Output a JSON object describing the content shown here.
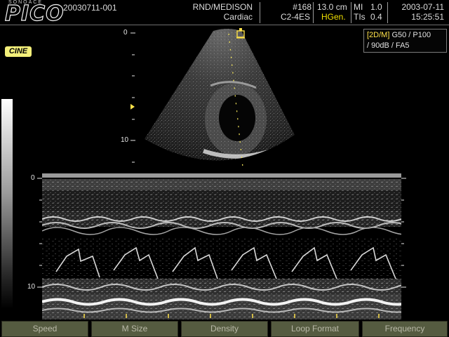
{
  "header": {
    "brand_small": "SONOACE",
    "brand_main": "PICO",
    "patient_id": "20030711-001",
    "institution": "RND/MEDISON",
    "application": "Cardiac",
    "image_number": "#168",
    "probe": "C2-4ES",
    "depth": "13.0 cm",
    "mode_mark": "HGen.",
    "mi_label": "MI",
    "mi_value": "1.0",
    "tis_label": "TIs",
    "tis_value": "0.4",
    "date": "2003-07-11",
    "time": "15:25:51"
  },
  "status": {
    "cine_label": "CINE"
  },
  "parameters": {
    "mode": "[2D/M]",
    "line1": " G50 / P100",
    "line2": "/ 90dB / FA5"
  },
  "depth_scale_2d": [
    "0",
    "10"
  ],
  "depth_scale_mmode": [
    "0",
    "10"
  ],
  "softkeys": [
    "Speed",
    "M Size",
    "Density",
    "Loop Format",
    "Frequency"
  ],
  "colors": {
    "mode_tag": "#ffe24a",
    "cine_badge": "#f3ef7a",
    "softkey_bg": "#555b40"
  },
  "icons": [
    "focus-marker-icon",
    "probe-orientation-icon",
    "grayscale-bar"
  ]
}
